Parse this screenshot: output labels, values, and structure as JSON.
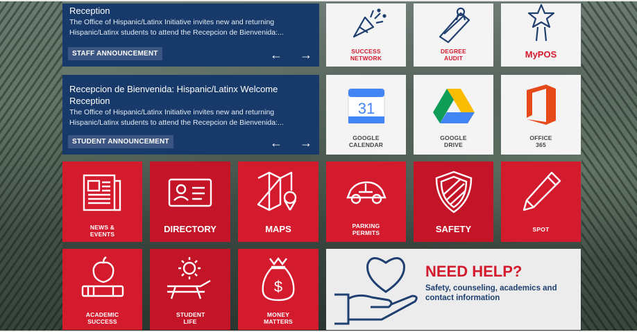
{
  "news": [
    {
      "title": "Reception",
      "description": "The Office of Hispanic/Latinx Initiative invites new and returning Hispanic/Latinx students to attend the Recepcion de Bienvenida:...",
      "tag": "STAFF ANNOUNCEMENT",
      "prev": "←",
      "next": "→"
    },
    {
      "title": "Recepcion de Bienvenida: Hispanic/Latinx Welcome Reception",
      "description": "The Office of Hispanic/Latinx Initiative invites new and returning Hispanic/Latinx students to attend the Recepcion de Bienvenida:...",
      "tag": "STUDENT ANNOUNCEMENT",
      "prev": "←",
      "next": "→"
    }
  ],
  "tiles": {
    "success_network": "SUCCESS NETWORK",
    "degree_audit": "DEGREE AUDIT",
    "mypos": "MyPOS",
    "google_calendar": "GOOGLE CALENDAR",
    "calendar_day": "31",
    "google_drive": "GOOGLE DRIVE",
    "office365": "OFFICE 365",
    "news_events": "NEWS & EVENTS",
    "directory": "DIRECTORY",
    "maps": "MAPS",
    "parking_permits": "PARKING PERMITS",
    "safety": "SAFETY",
    "spot": "SPOT",
    "academic_success": "ACADEMIC SUCCESS",
    "student_life": "STUDENT LIFE",
    "money_matters": "MONEY MATTERS"
  },
  "help": {
    "title": "NEED HELP?",
    "subtitle": "Safety, counseling, academics and contact information"
  },
  "colors": {
    "navy": "#173a6b",
    "red": "#d41a2d",
    "tile_white": "#f4f4f4"
  }
}
